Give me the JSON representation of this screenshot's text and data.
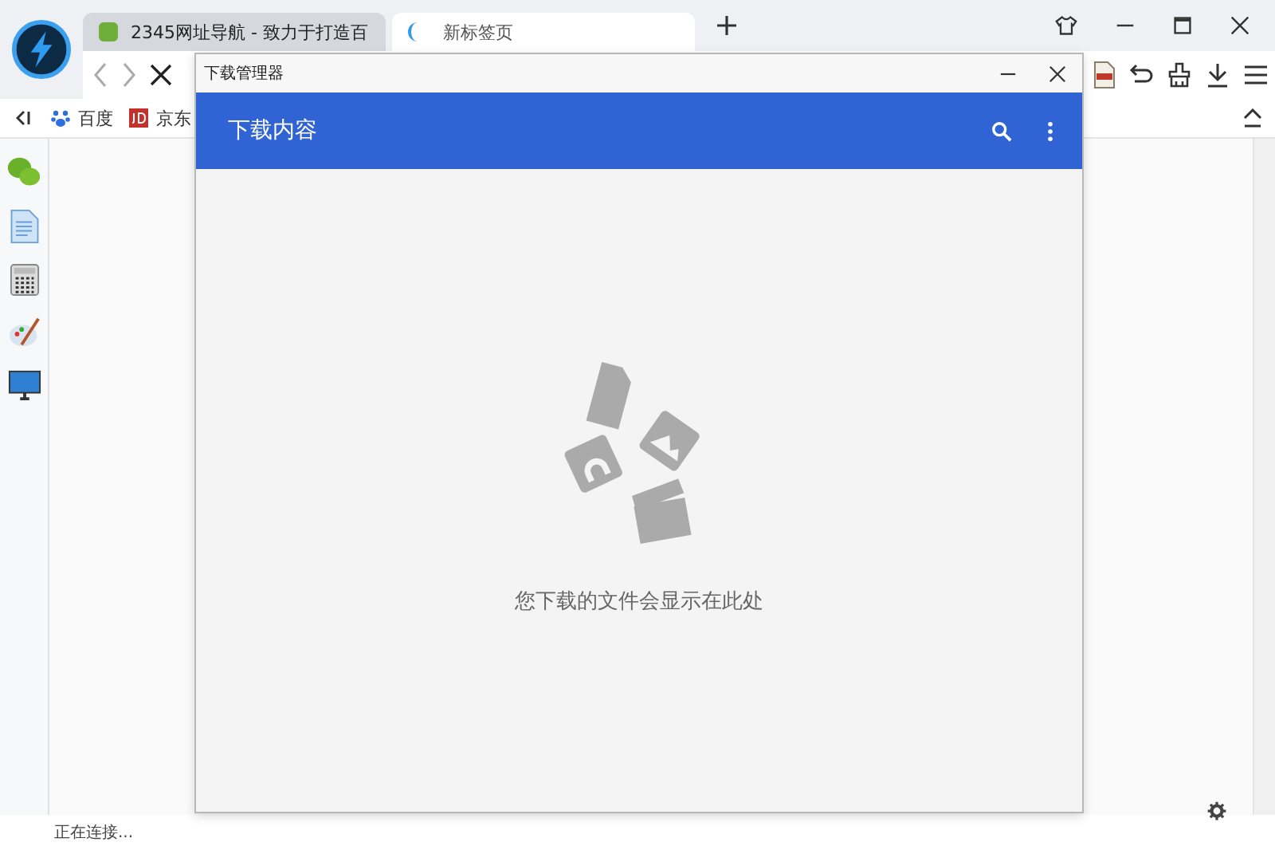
{
  "browser": {
    "tabs": [
      {
        "label": "2345网址导航 - 致力于打造百",
        "selected": false
      },
      {
        "label": "新标签页",
        "selected": true
      }
    ],
    "bookmarks": [
      {
        "label": "百度",
        "kind": "paw"
      },
      {
        "label": "京东",
        "kind": "jd"
      }
    ],
    "status_bar": "正在连接..."
  },
  "dialog": {
    "title": "下载管理器",
    "header": "下载内容",
    "empty_message": "您下载的文件会显示在此处"
  }
}
